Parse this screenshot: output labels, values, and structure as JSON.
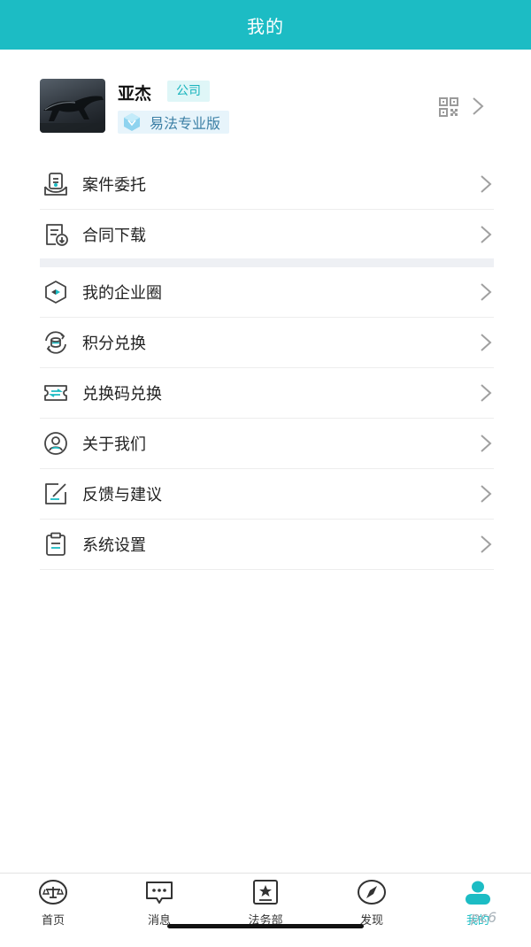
{
  "header": {
    "title": "我的"
  },
  "profile": {
    "name": "亚杰",
    "tag": "公司",
    "plan": "易法专业版"
  },
  "menu_group_1": [
    {
      "label": "案件委托",
      "icon": "case-delegate-icon"
    },
    {
      "label": "合同下载",
      "icon": "contract-download-icon"
    }
  ],
  "menu_group_2": [
    {
      "label": "我的企业圈",
      "icon": "enterprise-circle-icon"
    },
    {
      "label": "积分兑换",
      "icon": "points-exchange-icon"
    },
    {
      "label": "兑换码兑换",
      "icon": "redeem-code-icon"
    },
    {
      "label": "关于我们",
      "icon": "about-us-icon"
    },
    {
      "label": "反馈与建议",
      "icon": "feedback-icon"
    },
    {
      "label": "系统设置",
      "icon": "settings-icon"
    }
  ],
  "tabbar": {
    "items": [
      {
        "label": "首页",
        "icon": "home-scales-icon"
      },
      {
        "label": "消息",
        "icon": "message-icon"
      },
      {
        "label": "法务部",
        "icon": "legal-dept-icon"
      },
      {
        "label": "发现",
        "icon": "discover-icon"
      },
      {
        "label": "我的",
        "icon": "profile-icon"
      }
    ],
    "active": "我的"
  },
  "watermark": "pc6",
  "colors": {
    "accent": "#1cbcc4",
    "tag_bg": "#dff6f7",
    "plan_bg": "#e7f4fb"
  }
}
